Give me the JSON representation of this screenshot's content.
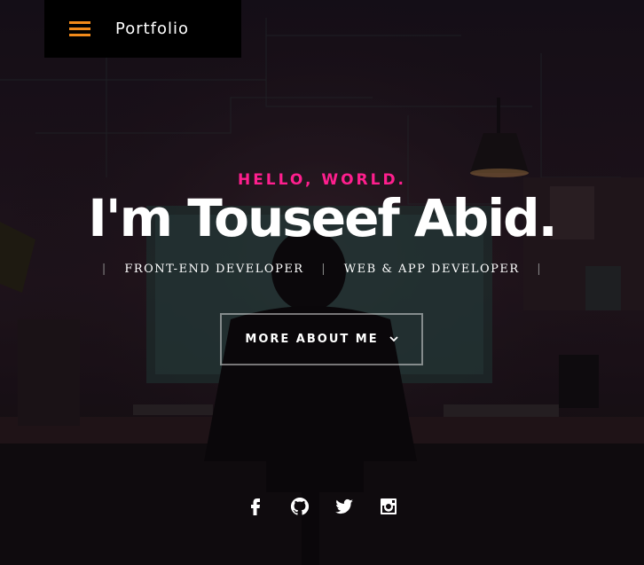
{
  "nav": {
    "brand": "Portfolio",
    "menu_icon": "hamburger-menu-icon",
    "accent": "#f28a1a"
  },
  "hero": {
    "greeting": "HELLO, WORLD.",
    "greeting_color": "#ff1f8e",
    "name": "I'm Touseef Abid.",
    "roles": [
      "FRONT-END DEVELOPER",
      "WEB & APP DEVELOPER"
    ],
    "cta_label": "MORE ABOUT ME",
    "cta_icon": "chevron-down-icon"
  },
  "social": [
    {
      "name": "facebook",
      "icon": "facebook-icon"
    },
    {
      "name": "github",
      "icon": "github-icon"
    },
    {
      "name": "twitter",
      "icon": "twitter-icon"
    },
    {
      "name": "instagram",
      "icon": "instagram-icon"
    }
  ]
}
